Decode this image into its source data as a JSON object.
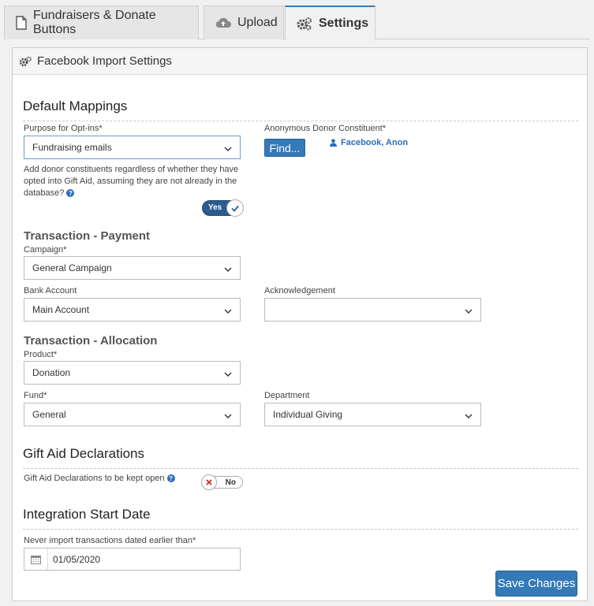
{
  "tabs": [
    {
      "label": "Fundraisers & Donate Buttons",
      "icon": "file-icon"
    },
    {
      "label": "Upload",
      "icon": "cloud-upload-icon"
    },
    {
      "label": "Settings",
      "icon": "gears-icon",
      "active": true
    }
  ],
  "panel": {
    "title": "Facebook Import Settings",
    "icon": "gears-icon"
  },
  "default_mappings": {
    "title": "Default Mappings",
    "purpose_label": "Purpose for Opt-ins*",
    "purpose_value": "Fundraising emails",
    "donor_label": "Anonymous Donor Constituent*",
    "find_button": "Find...",
    "donor_name": "Facebook, Anon",
    "gift_aid_note": "Add donor constituents regardless of whether they have opted into Gift Aid, assuming they are not already in the database?",
    "gift_aid_toggle": "Yes"
  },
  "payment": {
    "title": "Transaction - Payment",
    "campaign_label": "Campaign*",
    "campaign_value": "General Campaign",
    "bank_label": "Bank Account",
    "bank_value": "Main Account",
    "ack_label": "Acknowledgement",
    "ack_value": ""
  },
  "allocation": {
    "title": "Transaction - Allocation",
    "product_label": "Product*",
    "product_value": "Donation",
    "fund_label": "Fund*",
    "fund_value": "General",
    "dept_label": "Department",
    "dept_value": "Individual Giving"
  },
  "gift_aid": {
    "title": "Gift Aid Declarations",
    "kept_open_label": "Gift Aid Declarations to be kept open",
    "toggle": "No"
  },
  "integration": {
    "title": "Integration Start Date",
    "date_label": "Never import transactions dated earlier than*",
    "date_value": "01/05/2020"
  },
  "save_button": "Save Changes",
  "colors": {
    "primary": "#337ab7",
    "toggle_on": "#2b5c8f",
    "link": "#2a6ebb",
    "toggle_off_x": "#c9302c"
  }
}
